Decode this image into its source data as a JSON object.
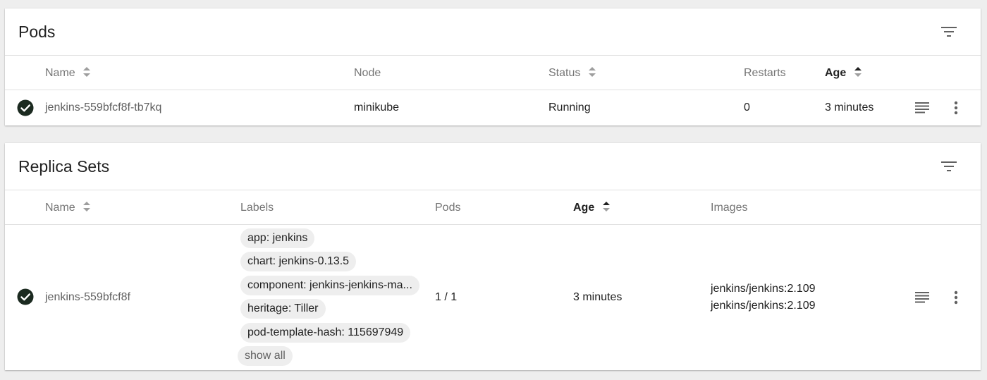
{
  "pods": {
    "title": "Pods",
    "columns": {
      "name": "Name",
      "node": "Node",
      "status": "Status",
      "restarts": "Restarts",
      "age": "Age"
    },
    "rows": [
      {
        "status_icon": "check-circle-icon",
        "name": "jenkins-559bfcf8f-tb7kq",
        "node": "minikube",
        "status": "Running",
        "restarts": "0",
        "age": "3 minutes"
      }
    ]
  },
  "replica_sets": {
    "title": "Replica Sets",
    "columns": {
      "name": "Name",
      "labels": "Labels",
      "pods": "Pods",
      "age": "Age",
      "images": "Images"
    },
    "rows": [
      {
        "status_icon": "check-circle-icon",
        "name": "jenkins-559bfcf8f",
        "labels": [
          "app: jenkins",
          "chart: jenkins-0.13.5",
          "component: jenkins-jenkins-ma...",
          "heritage: Tiller",
          "pod-template-hash: 115697949"
        ],
        "show_all": "show all",
        "pods": "1 / 1",
        "age": "3 minutes",
        "images": [
          "jenkins/jenkins:2.109",
          "jenkins/jenkins:2.109"
        ]
      }
    ]
  },
  "colors": {
    "background": "#eeeeee",
    "card": "#ffffff",
    "chip": "#eeeeee",
    "success": "#1b2a20",
    "header_text": "#757575"
  }
}
